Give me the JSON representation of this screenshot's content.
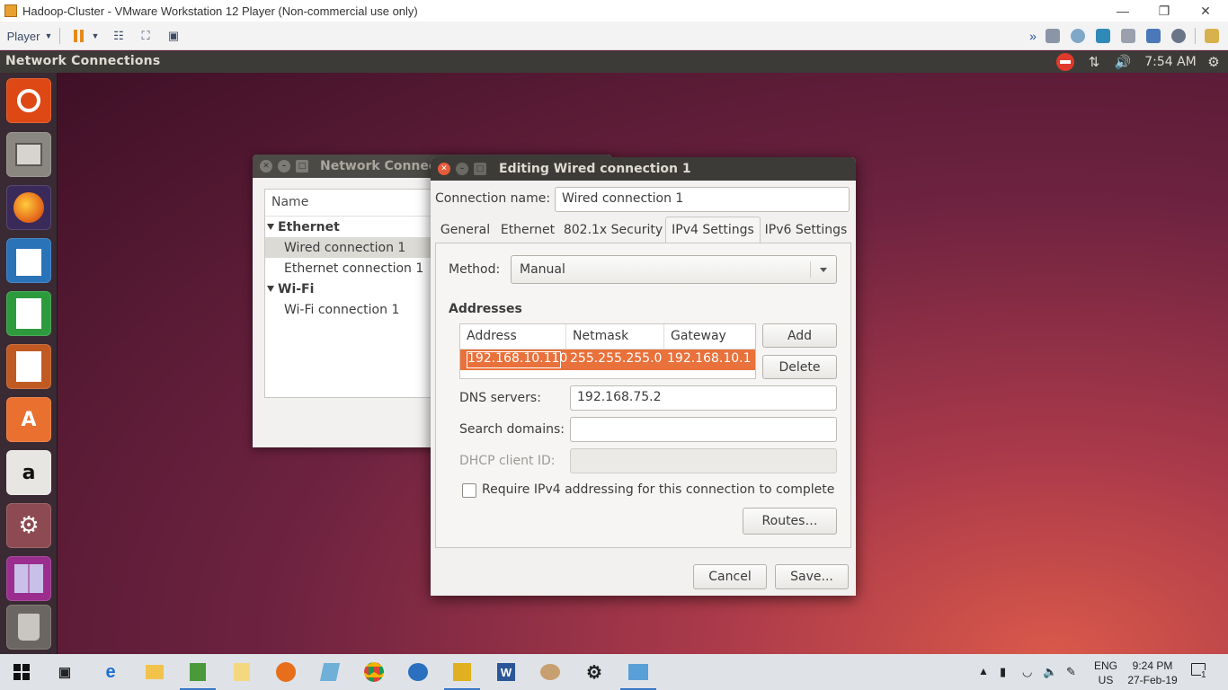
{
  "vmware": {
    "title": "Hadoop-Cluster - VMware Workstation 12 Player (Non-commercial use only)",
    "player_menu": "Player",
    "window_controls": [
      "minimize-icon",
      "restore-icon",
      "close-icon"
    ],
    "toolbar_icons": [
      "pause-icon",
      "send-ctrl-alt-del-icon",
      "fit-guest-icon",
      "unity-icon"
    ],
    "device_icons": [
      "arrow-right-icon",
      "hard-disk-icon",
      "cd-icon",
      "network-icon",
      "printer-icon",
      "sound-icon",
      "usb-icon",
      "message-log-icon"
    ]
  },
  "panel": {
    "app_title": "Network Connections",
    "time": "7:54 AM"
  },
  "launcher": [
    {
      "name": "dash-icon",
      "color": "#dd4814"
    },
    {
      "name": "files-icon",
      "color": "#8a8680"
    },
    {
      "name": "firefox-icon",
      "color": "#e76f1c"
    },
    {
      "name": "writer-icon",
      "color": "#2a73b8"
    },
    {
      "name": "calc-icon",
      "color": "#2e9a3e"
    },
    {
      "name": "impress-icon",
      "color": "#c05a22"
    },
    {
      "name": "software-center-icon",
      "color": "#e9702f"
    },
    {
      "name": "amazon-icon",
      "color": "#555555"
    },
    {
      "name": "system-settings-icon",
      "color": "#8d4a52"
    },
    {
      "name": "workspaces-icon",
      "color": "#9b2d8e"
    },
    {
      "name": "trash-icon",
      "color": "#6b6661"
    }
  ],
  "network_connections": {
    "title": "Network Connecti",
    "column": "Name",
    "groups": [
      {
        "label": "Ethernet",
        "items": [
          "Wired connection 1",
          "Ethernet connection 1"
        ]
      },
      {
        "label": "Wi-Fi",
        "items": [
          "Wi-Fi connection 1"
        ]
      }
    ]
  },
  "editor": {
    "title": "Editing Wired connection 1",
    "connection_name_label": "Connection name:",
    "connection_name_value": "Wired connection 1",
    "tabs": [
      "General",
      "Ethernet",
      "802.1x Security",
      "IPv4 Settings",
      "IPv6 Settings"
    ],
    "active_tab": "IPv4 Settings",
    "method_label": "Method:",
    "method_value": "Manual",
    "addresses_label": "Addresses",
    "table_headers": [
      "Address",
      "Netmask",
      "Gateway"
    ],
    "table_rows": [
      [
        "192.168.10.110",
        "255.255.255.0",
        "192.168.10.1"
      ]
    ],
    "add_button": "Add",
    "delete_button": "Delete",
    "dns_label": "DNS servers:",
    "dns_value": "192.168.75.2",
    "search_domains_label": "Search domains:",
    "search_domains_value": "",
    "dhcp_client_id_label": "DHCP client ID:",
    "dhcp_client_id_value": "",
    "require_ipv4_label": "Require IPv4 addressing for this connection to complete",
    "require_ipv4_checked": false,
    "routes_button": "Routes…",
    "cancel_button": "Cancel",
    "save_button": "Save..."
  },
  "taskbar": {
    "apps": [
      "task-view-icon",
      "edge-icon",
      "file-explorer-icon",
      "notepad-icon",
      "documents-icon",
      "firefox-icon",
      "app-icon",
      "chrome-icon",
      "outlook-icon",
      "app2-icon",
      "word-icon",
      "paint-icon",
      "settings-icon",
      "vmware-icon"
    ],
    "language_top": "ENG",
    "language_bottom": "US",
    "clock_time": "9:24 PM",
    "clock_date": "27-Feb-19",
    "notification_count": "1"
  }
}
